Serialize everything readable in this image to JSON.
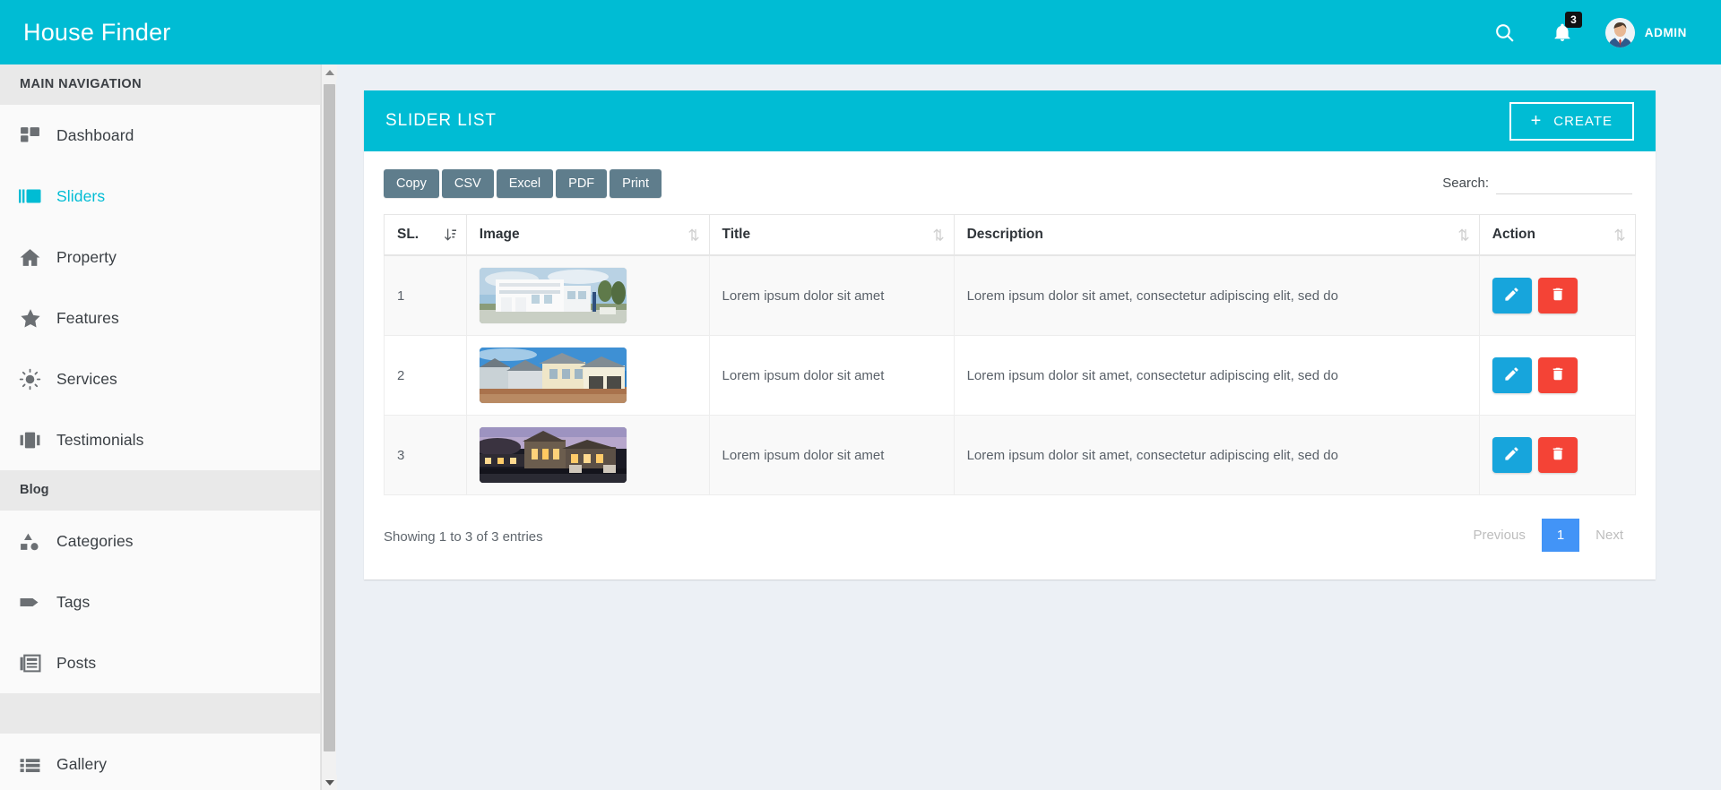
{
  "header": {
    "brand": "House Finder",
    "search_icon": "search-icon",
    "bell_icon": "bell-icon",
    "notification_count": "3",
    "user_name": "ADMIN",
    "brand_color": "#00bcd4"
  },
  "sidebar": {
    "sections": [
      {
        "type": "header",
        "label": "MAIN NAVIGATION"
      },
      {
        "type": "item",
        "label": "Dashboard",
        "icon": "dashboard-icon",
        "active": false
      },
      {
        "type": "item",
        "label": "Sliders",
        "icon": "image-slider-icon",
        "active": true
      },
      {
        "type": "item",
        "label": "Property",
        "icon": "home-icon",
        "active": false
      },
      {
        "type": "item",
        "label": "Features",
        "icon": "star-icon",
        "active": false
      },
      {
        "type": "item",
        "label": "Services",
        "icon": "sun-icon",
        "active": false
      },
      {
        "type": "item",
        "label": "Testimonials",
        "icon": "columns-icon",
        "active": false
      },
      {
        "type": "header",
        "label": "Blog"
      },
      {
        "type": "item",
        "label": "Categories",
        "icon": "shapes-icon",
        "active": false
      },
      {
        "type": "item",
        "label": "Tags",
        "icon": "tag-icon",
        "active": false
      },
      {
        "type": "item",
        "label": "Posts",
        "icon": "newspaper-icon",
        "active": false
      },
      {
        "type": "header",
        "label": ""
      },
      {
        "type": "item",
        "label": "Gallery",
        "icon": "list-icon",
        "active": false
      }
    ]
  },
  "box": {
    "title": "SLIDER LIST",
    "create_label": "CREATE",
    "create_icon": "plus-icon"
  },
  "datatable": {
    "export_buttons": [
      "Copy",
      "CSV",
      "Excel",
      "PDF",
      "Print"
    ],
    "search_label": "Search:",
    "search_value": "",
    "search_placeholder": "",
    "columns": [
      "SL.",
      "Image",
      "Title",
      "Description",
      "Action"
    ],
    "rows": [
      {
        "sl": "1",
        "image_alt": "white-multistory-beach-house",
        "title": "Lorem ipsum dolor sit amet",
        "description": "Lorem ipsum dolor sit amet, consectetur adipiscing elit, sed do",
        "edit_label": "edit-icon",
        "delete_label": "trash-icon"
      },
      {
        "sl": "2",
        "image_alt": "suburban-houses-under-construction",
        "title": "Lorem ipsum dolor sit amet",
        "description": "Lorem ipsum dolor sit amet, consectetur adipiscing elit, sed do",
        "edit_label": "edit-icon",
        "delete_label": "trash-icon"
      },
      {
        "sl": "3",
        "image_alt": "illuminated-house-at-dusk",
        "title": "Lorem ipsum dolor sit amet",
        "description": "Lorem ipsum dolor sit amet, consectetur adipiscing elit, sed do",
        "edit_label": "edit-icon",
        "delete_label": "trash-icon"
      }
    ],
    "info": "Showing 1 to 3 of 3 entries",
    "pagination": {
      "previous": "Previous",
      "pages": [
        "1"
      ],
      "next": "Next",
      "active_page": "1"
    }
  }
}
